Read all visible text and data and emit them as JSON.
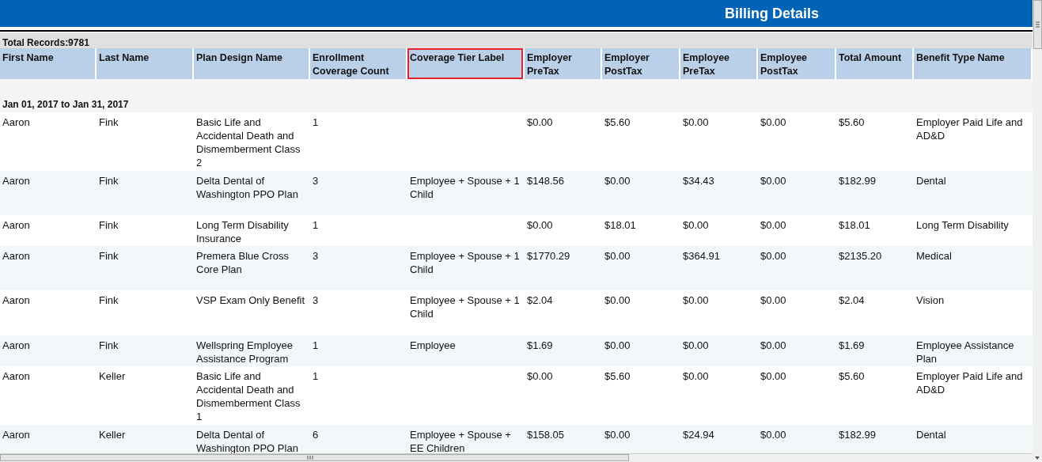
{
  "title": "Billing Details",
  "total_records": "Total Records:9781",
  "columns": [
    {
      "label": "First Name",
      "highlighted": false
    },
    {
      "label": "Last Name",
      "highlighted": false
    },
    {
      "label": "Plan Design Name",
      "highlighted": false
    },
    {
      "label": "Enrollment Coverage Count",
      "highlighted": false
    },
    {
      "label": "Coverage Tier Label",
      "highlighted": true
    },
    {
      "label": "Employer PreTax",
      "highlighted": false
    },
    {
      "label": "Employer PostTax",
      "highlighted": false
    },
    {
      "label": "Employee PreTax",
      "highlighted": false
    },
    {
      "label": "Employee PostTax",
      "highlighted": false
    },
    {
      "label": "Total Amount",
      "highlighted": false
    },
    {
      "label": "Benefit Type Name",
      "highlighted": false
    }
  ],
  "group": "Jan 01, 2017 to Jan 31, 2017",
  "rows": [
    [
      "Aaron",
      "Fink",
      "Basic Life and Accidental Death and Dismemberment Class 2",
      "1",
      "",
      "$0.00",
      "$5.60",
      "$0.00",
      "$0.00",
      "$5.60",
      "Employer Paid Life and AD&D"
    ],
    [
      "Aaron",
      "Fink",
      "Delta Dental of Washington PPO Plan",
      "3",
      "Employee + Spouse + 1 Child",
      "$148.56",
      "$0.00",
      "$34.43",
      "$0.00",
      "$182.99",
      "Dental"
    ],
    [
      "Aaron",
      "Fink",
      "Long Term Disability Insurance",
      "1",
      "",
      "$0.00",
      "$18.01",
      "$0.00",
      "$0.00",
      "$18.01",
      "Long Term Disability"
    ],
    [
      "Aaron",
      "Fink",
      "Premera Blue Cross Core Plan",
      "3",
      "Employee + Spouse + 1 Child",
      "$1770.29",
      "$0.00",
      "$364.91",
      "$0.00",
      "$2135.20",
      "Medical"
    ],
    [
      "Aaron",
      "Fink",
      "VSP Exam Only Benefit",
      "3",
      "Employee + Spouse + 1 Child",
      "$2.04",
      "$0.00",
      "$0.00",
      "$0.00",
      "$2.04",
      "Vision"
    ],
    [
      "Aaron",
      "Fink",
      "Wellspring Employee Assistance Program",
      "1",
      "Employee",
      "$1.69",
      "$0.00",
      "$0.00",
      "$0.00",
      "$1.69",
      "Employee Assistance Plan"
    ],
    [
      "Aaron",
      "Keller",
      "Basic Life and Accidental Death and Dismemberment Class 1",
      "1",
      "",
      "$0.00",
      "$5.60",
      "$0.00",
      "$0.00",
      "$5.60",
      "Employer Paid Life and AD&D"
    ],
    [
      "Aaron",
      "Keller",
      "Delta Dental of Washington PPO Plan",
      "6",
      "Employee + Spouse + EE Children",
      "$158.05",
      "$0.00",
      "$24.94",
      "$0.00",
      "$182.99",
      "Dental"
    ]
  ]
}
